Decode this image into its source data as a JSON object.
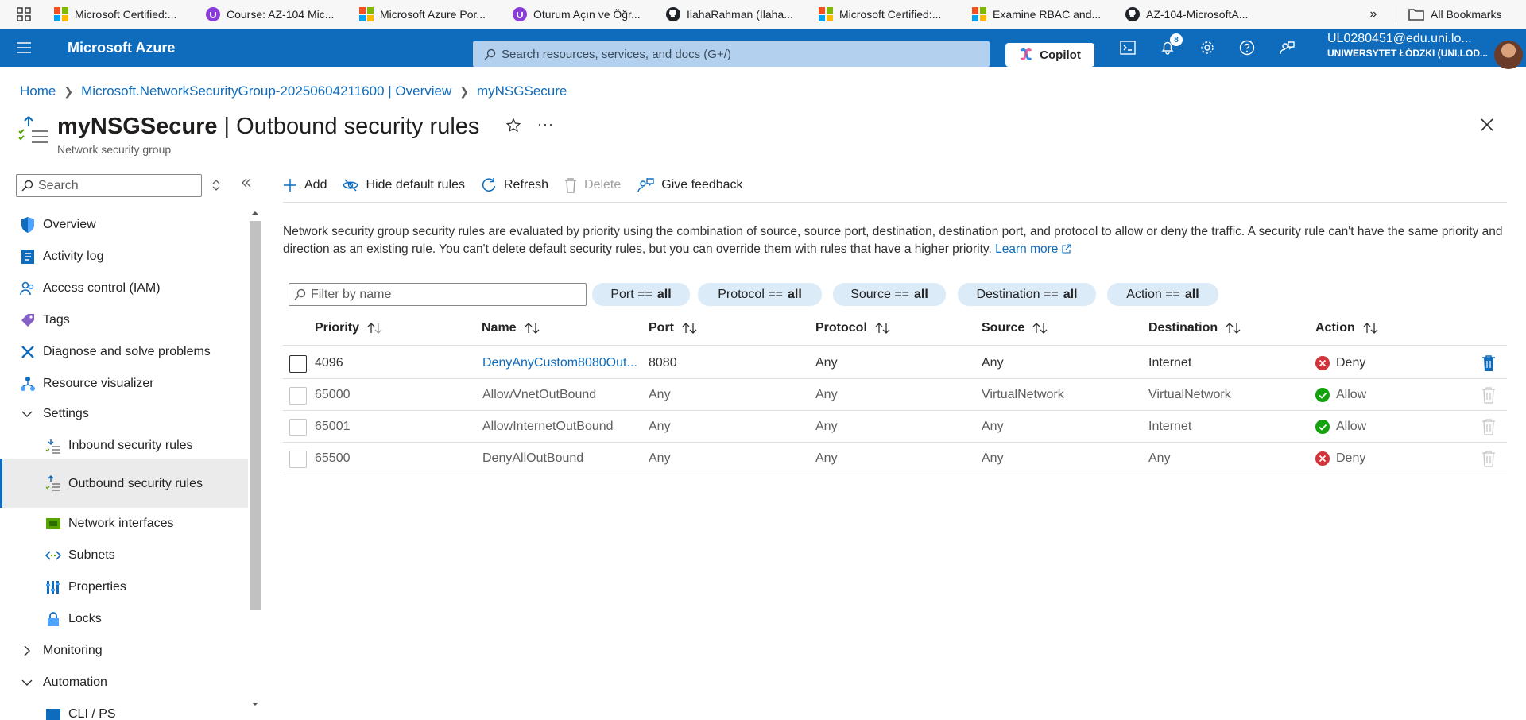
{
  "browser": {
    "bookmarks": [
      {
        "label": "Microsoft Certified:...",
        "icon": "microsoft-logo-icon"
      },
      {
        "label": "Course: AZ-104 Mic...",
        "icon": "udemy-icon"
      },
      {
        "label": "Microsoft Azure Por...",
        "icon": "microsoft-logo-icon"
      },
      {
        "label": "Oturum Açın ve Öğr...",
        "icon": "udemy-icon"
      },
      {
        "label": "IlahaRahman (Ilaha...",
        "icon": "github-icon"
      },
      {
        "label": "Microsoft Certified:...",
        "icon": "microsoft-logo-icon"
      },
      {
        "label": "Examine RBAC and...",
        "icon": "microsoft-logo-icon"
      },
      {
        "label": "AZ-104-MicrosoftA...",
        "icon": "github-icon"
      }
    ],
    "more_label": "»",
    "all_bookmarks": "All Bookmarks"
  },
  "topbar": {
    "brand": "Microsoft Azure",
    "search_placeholder": "Search resources, services, and docs (G+/)",
    "copilot": "Copilot",
    "notifications_count": "8",
    "account_email": "UL0280451@edu.uni.lo...",
    "account_org": "UNIWERSYTET ŁÓDZKI (UNI.LOD..."
  },
  "breadcrumb": [
    "Home",
    "Microsoft.NetworkSecurityGroup-20250604211600 | Overview",
    "myNSGSecure"
  ],
  "header": {
    "resource": "myNSGSecure",
    "page": " | Outbound security rules",
    "subtitle": "Network security group"
  },
  "sidebar": {
    "search_placeholder": "Search",
    "items": [
      {
        "label": "Overview",
        "icon": "shield-icon"
      },
      {
        "label": "Activity log",
        "icon": "activity-log-icon"
      },
      {
        "label": "Access control (IAM)",
        "icon": "people-icon"
      },
      {
        "label": "Tags",
        "icon": "tag-icon"
      },
      {
        "label": "Diagnose and solve problems",
        "icon": "wrench-icon"
      },
      {
        "label": "Resource visualizer",
        "icon": "visualizer-icon"
      },
      {
        "label": "Settings",
        "icon": "chevron-down-icon"
      },
      {
        "label": "Inbound security rules",
        "icon": "inbound-rules-icon"
      },
      {
        "label": "Outbound security rules",
        "icon": "outbound-rules-icon"
      },
      {
        "label": "Network interfaces",
        "icon": "network-interface-icon"
      },
      {
        "label": "Subnets",
        "icon": "subnet-icon"
      },
      {
        "label": "Properties",
        "icon": "properties-icon"
      },
      {
        "label": "Locks",
        "icon": "lock-icon"
      },
      {
        "label": "Monitoring",
        "icon": "chevron-right-icon"
      },
      {
        "label": "Automation",
        "icon": "chevron-down-icon"
      },
      {
        "label": "CLI / PS",
        "icon": "cli-icon"
      }
    ]
  },
  "toolbar": {
    "add": "Add",
    "hide_default": "Hide default rules",
    "refresh": "Refresh",
    "delete": "Delete",
    "feedback": "Give feedback"
  },
  "description": {
    "text": "Network security group security rules are evaluated by priority using the combination of source, source port, destination, destination port, and protocol to allow or deny the traffic. A security rule can't have the same priority and direction as an existing rule. You can't delete default security rules, but you can override them with rules that have a higher priority.",
    "link": "Learn more"
  },
  "filters": {
    "placeholder": "Filter by name",
    "pills": [
      {
        "label": "Port ==",
        "value": "all"
      },
      {
        "label": "Protocol ==",
        "value": "all"
      },
      {
        "label": "Source ==",
        "value": "all"
      },
      {
        "label": "Destination ==",
        "value": "all"
      },
      {
        "label": "Action ==",
        "value": "all"
      }
    ]
  },
  "table": {
    "columns": [
      "Priority",
      "Name",
      "Port",
      "Protocol",
      "Source",
      "Destination",
      "Action"
    ],
    "rows": [
      {
        "priority": "4096",
        "name": "DenyAnyCustom8080Out...",
        "port": "8080",
        "protocol": "Any",
        "source": "Any",
        "destination": "Internet",
        "action": "Deny"
      },
      {
        "priority": "65000",
        "name": "AllowVnetOutBound",
        "port": "Any",
        "protocol": "Any",
        "source": "VirtualNetwork",
        "destination": "VirtualNetwork",
        "action": "Allow"
      },
      {
        "priority": "65001",
        "name": "AllowInternetOutBound",
        "port": "Any",
        "protocol": "Any",
        "source": "Any",
        "destination": "Internet",
        "action": "Allow"
      },
      {
        "priority": "65500",
        "name": "DenyAllOutBound",
        "port": "Any",
        "protocol": "Any",
        "source": "Any",
        "destination": "Any",
        "action": "Deny"
      }
    ]
  },
  "colors": {
    "azure_blue": "#0f6cbd",
    "deny_red": "#d13438",
    "allow_green": "#107c10",
    "pill_bg": "#dcebf8"
  }
}
